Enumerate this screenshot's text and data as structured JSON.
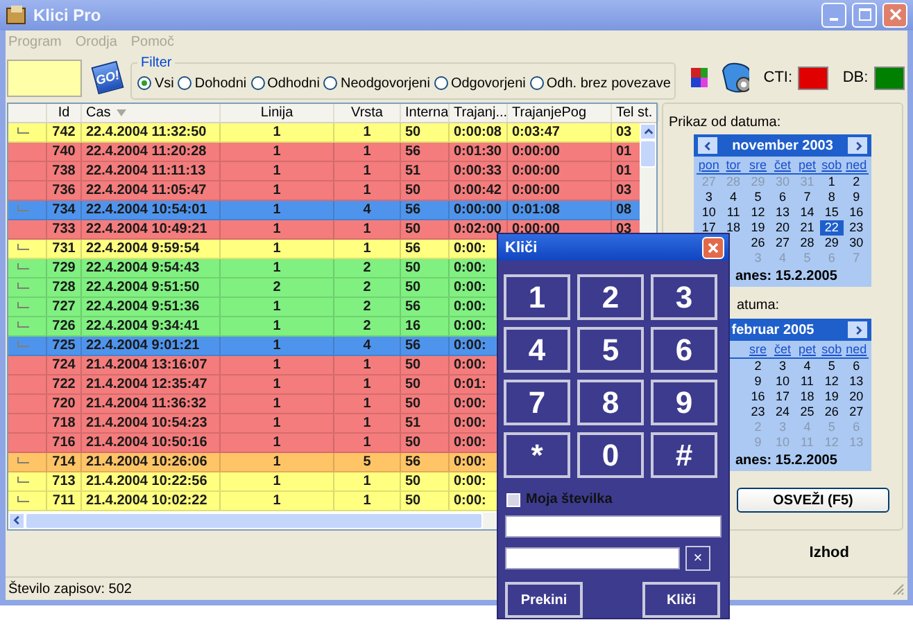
{
  "window": {
    "title": "Klici Pro"
  },
  "menu": [
    {
      "label": "Program",
      "disabled": true
    },
    {
      "label": "Orodja",
      "disabled": true
    },
    {
      "label": "Pomoč",
      "disabled": true
    }
  ],
  "toolbar": {
    "go_label": "GO!",
    "filter": {
      "legend": "Filter",
      "options": [
        {
          "label": "Vsi",
          "selected": true
        },
        {
          "label": "Dohodni",
          "selected": false
        },
        {
          "label": "Odhodni",
          "selected": false
        },
        {
          "label": "Neodgovorjeni",
          "selected": false
        },
        {
          "label": "Odgovorjeni",
          "selected": false
        },
        {
          "label": "Odh. brez povezave",
          "selected": false
        }
      ]
    },
    "indicators": [
      {
        "label": "CTI:",
        "color": "#e00000"
      },
      {
        "label": "DB:",
        "color": "#008000"
      }
    ]
  },
  "table": {
    "columns": [
      {
        "label": "Id",
        "sorted": false
      },
      {
        "label": "Cas",
        "sorted": true
      },
      {
        "label": "Linija",
        "sorted": false
      },
      {
        "label": "Vrsta",
        "sorted": false
      },
      {
        "label": "Interna",
        "sorted": false
      },
      {
        "label": "Trajanj...",
        "sorted": false
      },
      {
        "label": "TrajanjePog",
        "sorted": false
      },
      {
        "label": "Tel st.",
        "sorted": false
      }
    ],
    "rows": [
      {
        "linked": true,
        "color": "#ffff80",
        "id": "742",
        "cas": "22.4.2004 11:32:50",
        "linija": "1",
        "vrsta": "1",
        "interna": "50",
        "trajanje": "0:00:08",
        "trajanje_pog": "0:03:47",
        "tel_st": "03"
      },
      {
        "linked": false,
        "color": "#f47c7c",
        "id": "740",
        "cas": "22.4.2004 11:20:28",
        "linija": "1",
        "vrsta": "1",
        "interna": "56",
        "trajanje": "0:01:30",
        "trajanje_pog": "0:00:00",
        "tel_st": "01"
      },
      {
        "linked": false,
        "color": "#f47c7c",
        "id": "738",
        "cas": "22.4.2004 11:11:13",
        "linija": "1",
        "vrsta": "1",
        "interna": "51",
        "trajanje": "0:00:33",
        "trajanje_pog": "0:00:00",
        "tel_st": "01"
      },
      {
        "linked": false,
        "color": "#f47c7c",
        "id": "736",
        "cas": "22.4.2004 11:05:47",
        "linija": "1",
        "vrsta": "1",
        "interna": "50",
        "trajanje": "0:00:42",
        "trajanje_pog": "0:00:00",
        "tel_st": "03"
      },
      {
        "linked": true,
        "color": "#4f94ec",
        "id": "734",
        "cas": "22.4.2004 10:54:01",
        "linija": "1",
        "vrsta": "4",
        "interna": "56",
        "trajanje": "0:00:00",
        "trajanje_pog": "0:01:08",
        "tel_st": "08"
      },
      {
        "linked": false,
        "color": "#f47c7c",
        "id": "733",
        "cas": "22.4.2004 10:49:21",
        "linija": "1",
        "vrsta": "1",
        "interna": "50",
        "trajanje": "0:02:00",
        "trajanje_pog": "0:00:00",
        "tel_st": "03"
      },
      {
        "linked": true,
        "color": "#ffff80",
        "id": "731",
        "cas": "22.4.2004 9:59:54",
        "linija": "1",
        "vrsta": "1",
        "interna": "56",
        "trajanje": "0:00:"
      },
      {
        "linked": true,
        "color": "#80f080",
        "id": "729",
        "cas": "22.4.2004 9:54:43",
        "linija": "1",
        "vrsta": "2",
        "interna": "50",
        "trajanje": "0:00:"
      },
      {
        "linked": true,
        "color": "#80f080",
        "id": "728",
        "cas": "22.4.2004 9:51:50",
        "linija": "2",
        "vrsta": "2",
        "interna": "50",
        "trajanje": "0:00:"
      },
      {
        "linked": true,
        "color": "#80f080",
        "id": "727",
        "cas": "22.4.2004 9:51:36",
        "linija": "1",
        "vrsta": "2",
        "interna": "56",
        "trajanje": "0:00:"
      },
      {
        "linked": true,
        "color": "#80f080",
        "id": "726",
        "cas": "22.4.2004 9:34:41",
        "linija": "1",
        "vrsta": "2",
        "interna": "16",
        "trajanje": "0:00:"
      },
      {
        "linked": true,
        "color": "#4f94ec",
        "id": "725",
        "cas": "22.4.2004 9:01:21",
        "linija": "1",
        "vrsta": "4",
        "interna": "56",
        "trajanje": "0:00:"
      },
      {
        "linked": false,
        "color": "#f47c7c",
        "id": "724",
        "cas": "21.4.2004 13:16:07",
        "linija": "1",
        "vrsta": "1",
        "interna": "50",
        "trajanje": "0:00:"
      },
      {
        "linked": false,
        "color": "#f47c7c",
        "id": "722",
        "cas": "21.4.2004 12:35:47",
        "linija": "1",
        "vrsta": "1",
        "interna": "50",
        "trajanje": "0:01:"
      },
      {
        "linked": false,
        "color": "#f47c7c",
        "id": "720",
        "cas": "21.4.2004 11:36:32",
        "linija": "1",
        "vrsta": "1",
        "interna": "50",
        "trajanje": "0:00:"
      },
      {
        "linked": false,
        "color": "#f47c7c",
        "id": "718",
        "cas": "21.4.2004 10:54:23",
        "linija": "1",
        "vrsta": "1",
        "interna": "51",
        "trajanje": "0:00:"
      },
      {
        "linked": false,
        "color": "#f47c7c",
        "id": "716",
        "cas": "21.4.2004 10:50:16",
        "linija": "1",
        "vrsta": "1",
        "interna": "50",
        "trajanje": "0:00:"
      },
      {
        "linked": true,
        "color": "#ffc466",
        "id": "714",
        "cas": "21.4.2004 10:26:06",
        "linija": "1",
        "vrsta": "5",
        "interna": "56",
        "trajanje": "0:00:"
      },
      {
        "linked": true,
        "color": "#ffff80",
        "id": "713",
        "cas": "21.4.2004 10:22:56",
        "linija": "1",
        "vrsta": "1",
        "interna": "50",
        "trajanje": "0:00:"
      },
      {
        "linked": true,
        "color": "#ffff80",
        "id": "711",
        "cas": "21.4.2004 10:02:22",
        "linija": "1",
        "vrsta": "1",
        "interna": "50",
        "trajanje": "0:00:"
      }
    ]
  },
  "calendars": [
    {
      "label": "Prikaz od datuma:",
      "partly_covered": false,
      "month": "november 2003",
      "weekdays": [
        "pon",
        "tor",
        "sre",
        "čet",
        "pet",
        "sob",
        "ned"
      ],
      "weeks": [
        [
          {
            "d": "27",
            "muted": true,
            "selected": false
          },
          {
            "d": "28",
            "muted": true,
            "selected": false
          },
          {
            "d": "29",
            "muted": true,
            "selected": false
          },
          {
            "d": "30",
            "muted": true,
            "selected": false
          },
          {
            "d": "31",
            "muted": true,
            "selected": false
          },
          {
            "d": "1",
            "muted": false,
            "selected": false
          },
          {
            "d": "2",
            "muted": false,
            "selected": false
          }
        ],
        [
          {
            "d": "3",
            "muted": false,
            "selected": false
          },
          {
            "d": "4",
            "muted": false,
            "selected": false
          },
          {
            "d": "5",
            "muted": false,
            "selected": false
          },
          {
            "d": "6",
            "muted": false,
            "selected": false
          },
          {
            "d": "7",
            "muted": false,
            "selected": false
          },
          {
            "d": "8",
            "muted": false,
            "selected": false
          },
          {
            "d": "9",
            "muted": false,
            "selected": false
          }
        ],
        [
          {
            "d": "10",
            "muted": false,
            "selected": false
          },
          {
            "d": "11",
            "muted": false,
            "selected": false
          },
          {
            "d": "12",
            "muted": false,
            "selected": false
          },
          {
            "d": "13",
            "muted": false,
            "selected": false
          },
          {
            "d": "14",
            "muted": false,
            "selected": false
          },
          {
            "d": "15",
            "muted": false,
            "selected": false
          },
          {
            "d": "16",
            "muted": false,
            "selected": false
          }
        ],
        [
          {
            "d": "17",
            "muted": false,
            "selected": false
          },
          {
            "d": "18",
            "muted": false,
            "selected": false
          },
          {
            "d": "19",
            "muted": false,
            "selected": false
          },
          {
            "d": "20",
            "muted": false,
            "selected": false
          },
          {
            "d": "21",
            "muted": false,
            "selected": false
          },
          {
            "d": "22",
            "muted": false,
            "selected": true
          },
          {
            "d": "23",
            "muted": false,
            "selected": false
          }
        ],
        [
          {
            "d": "26",
            "muted": false,
            "selected": false
          },
          {
            "d": "27",
            "muted": false,
            "selected": false
          },
          {
            "d": "28",
            "muted": false,
            "selected": false
          },
          {
            "d": "29",
            "muted": false,
            "selected": false
          },
          {
            "d": "30",
            "muted": false,
            "selected": false
          }
        ],
        [
          {
            "d": "3",
            "muted": true,
            "selected": false
          },
          {
            "d": "4",
            "muted": true,
            "selected": false
          },
          {
            "d": "5",
            "muted": true,
            "selected": false
          },
          {
            "d": "6",
            "muted": true,
            "selected": false
          },
          {
            "d": "7",
            "muted": true,
            "selected": false
          }
        ]
      ],
      "today": "anes: 15.2.2005"
    },
    {
      "label": "atuma:",
      "partly_covered": true,
      "month": "februar 2005",
      "weekdays": [
        "sre",
        "čet",
        "pet",
        "sob",
        "ned"
      ],
      "weeks": [
        [
          {
            "d": "2",
            "muted": false,
            "selected": false
          },
          {
            "d": "3",
            "muted": false,
            "selected": false
          },
          {
            "d": "4",
            "muted": false,
            "selected": false
          },
          {
            "d": "5",
            "muted": false,
            "selected": false
          },
          {
            "d": "6",
            "muted": false,
            "selected": false
          }
        ],
        [
          {
            "d": "9",
            "muted": false,
            "selected": false
          },
          {
            "d": "10",
            "muted": false,
            "selected": false
          },
          {
            "d": "11",
            "muted": false,
            "selected": false
          },
          {
            "d": "12",
            "muted": false,
            "selected": false
          },
          {
            "d": "13",
            "muted": false,
            "selected": false
          }
        ],
        [
          {
            "d": "16",
            "muted": false,
            "selected": false
          },
          {
            "d": "17",
            "muted": false,
            "selected": false
          },
          {
            "d": "18",
            "muted": false,
            "selected": false
          },
          {
            "d": "19",
            "muted": false,
            "selected": false
          },
          {
            "d": "20",
            "muted": false,
            "selected": false
          }
        ],
        [
          {
            "d": "23",
            "muted": false,
            "selected": false
          },
          {
            "d": "24",
            "muted": false,
            "selected": false
          },
          {
            "d": "25",
            "muted": false,
            "selected": false
          },
          {
            "d": "26",
            "muted": false,
            "selected": false
          },
          {
            "d": "27",
            "muted": false,
            "selected": false
          }
        ],
        [
          {
            "d": "2",
            "muted": true,
            "selected": false
          },
          {
            "d": "3",
            "muted": true,
            "selected": false
          },
          {
            "d": "4",
            "muted": true,
            "selected": false
          },
          {
            "d": "5",
            "muted": true,
            "selected": false
          },
          {
            "d": "6",
            "muted": true,
            "selected": false
          }
        ],
        [
          {
            "d": "9",
            "muted": true,
            "selected": false
          },
          {
            "d": "10",
            "muted": true,
            "selected": false
          },
          {
            "d": "11",
            "muted": true,
            "selected": false
          },
          {
            "d": "12",
            "muted": true,
            "selected": false
          },
          {
            "d": "13",
            "muted": true,
            "selected": false
          }
        ]
      ],
      "today": "anes: 15.2.2005"
    }
  ],
  "refresh_button": "OSVEŽI (F5)",
  "exit_button": "Izhod",
  "status_bar": "Število zapisov: 502",
  "dialog": {
    "title": "Kliči",
    "keys": [
      "1",
      "2",
      "3",
      "4",
      "5",
      "6",
      "7",
      "8",
      "9",
      "*",
      "0",
      "#"
    ],
    "own_number": {
      "label": "Moja številka",
      "checked": false
    },
    "clear_label": "×",
    "buttons": [
      "Prekini",
      "Kliči"
    ]
  }
}
